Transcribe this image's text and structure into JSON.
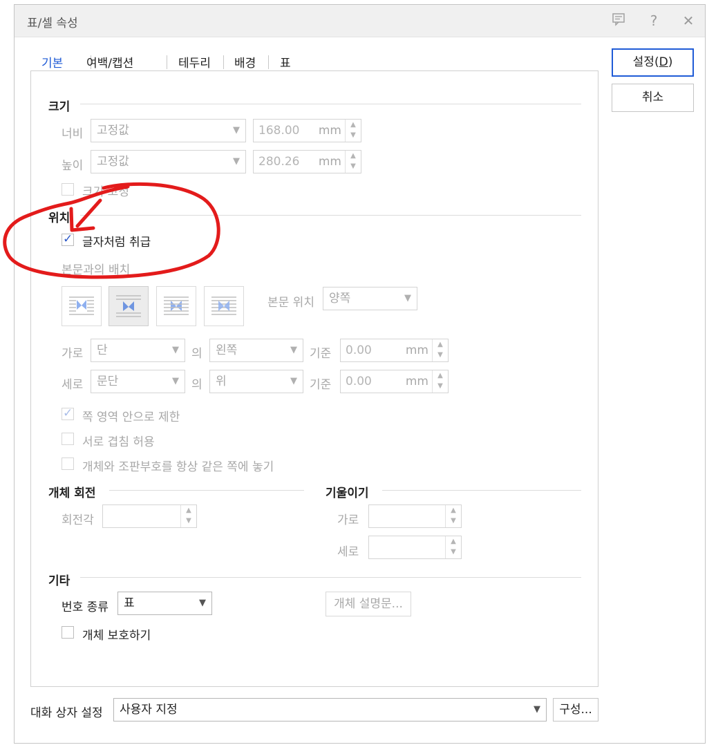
{
  "window": {
    "title": "표/셀 속성",
    "icons": [
      "comment-icon",
      "help-icon",
      "close-icon"
    ],
    "help_glyph": "?",
    "close_glyph": "✕"
  },
  "tabs": [
    {
      "label": "기본",
      "active": true
    },
    {
      "label": "여백/캡션"
    },
    {
      "label": "테두리"
    },
    {
      "label": "배경"
    },
    {
      "label": "표"
    }
  ],
  "buttons": {
    "ok": "설정(D)",
    "ok_mnemonic_prefix": "설정(",
    "ok_mnemonic": "D",
    "ok_mnemonic_suffix": ")",
    "cancel": "취소"
  },
  "size": {
    "title": "크기",
    "width": {
      "label": "너비",
      "mode": "고정값",
      "value": "168.00",
      "unit": "mm"
    },
    "height": {
      "label": "높이",
      "mode": "고정값",
      "value": "280.26",
      "unit": "mm"
    },
    "fix_size": {
      "label": "크기 고정",
      "checked": false
    }
  },
  "position": {
    "title": "위치",
    "treat_as_char": {
      "label": "글자처럼 취급",
      "checked": true
    },
    "wrap_label": "본문과의 배치",
    "text_pos_label": "본문 위치",
    "text_pos_value": "양쪽",
    "horizontal": {
      "label": "가로",
      "ref": "단",
      "of": "의",
      "align": "왼쪽",
      "base": "기준",
      "value": "0.00",
      "unit": "mm"
    },
    "vertical": {
      "label": "세로",
      "ref": "문단",
      "of": "의",
      "align": "위",
      "base": "기준",
      "value": "0.00",
      "unit": "mm"
    },
    "limit_page": {
      "label": "쪽 영역 안으로 제한",
      "checked": true
    },
    "allow_overlap": {
      "label": "서로 겹침 허용",
      "checked": false
    },
    "keep_same_page": {
      "label": "개체와 조판부호를 항상 같은 쪽에 놓기",
      "checked": false
    }
  },
  "rotation": {
    "title": "개체 회전",
    "angle_label": "회전각"
  },
  "skew": {
    "title": "기울이기",
    "horizontal_label": "가로",
    "vertical_label": "세로"
  },
  "etc": {
    "title": "기타",
    "number_type_label": "번호 종류",
    "number_type_value": "표",
    "description_button": "개체 설명문...",
    "protect": {
      "label": "개체 보호하기",
      "checked": false
    }
  },
  "footer": {
    "label": "대화 상자 설정",
    "value": "사용자 지정",
    "config_button": "구성..."
  },
  "colors": {
    "accent": "#1f5bd6",
    "annotation": "#e31b1b",
    "wrap_icon": "#8fb0ef"
  }
}
